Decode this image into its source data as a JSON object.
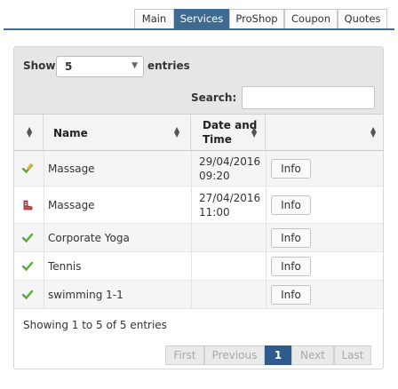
{
  "tabs": [
    {
      "label": "Main",
      "active": false
    },
    {
      "label": "Services",
      "active": true
    },
    {
      "label": "ProShop",
      "active": false
    },
    {
      "label": "Coupon",
      "active": false
    },
    {
      "label": "Quotes",
      "active": false
    }
  ],
  "controls": {
    "show_label": "Show",
    "page_size": "5",
    "entries_label": "entries",
    "search_label": "Search:",
    "search_value": ""
  },
  "table": {
    "headers": {
      "status": "",
      "name": "Name",
      "date_line1": "Date and",
      "date_line2": "Time",
      "action": ""
    },
    "rows": [
      {
        "status_icon": "check-pencil-icon",
        "name": "Massage",
        "date": "29/04/2016",
        "time": "09:20",
        "action": "Info"
      },
      {
        "status_icon": "pending-shoe-icon",
        "name": "Massage",
        "date": "27/04/2016",
        "time": "11:00",
        "action": "Info"
      },
      {
        "status_icon": "check-icon",
        "name": "Corporate Yoga",
        "date": "",
        "time": "",
        "action": "Info"
      },
      {
        "status_icon": "check-icon",
        "name": "Tennis",
        "date": "",
        "time": "",
        "action": "Info"
      },
      {
        "status_icon": "check-icon",
        "name": "swimming 1-1",
        "date": "",
        "time": "",
        "action": "Info"
      }
    ]
  },
  "summary": "Showing 1 to 5 of 5 entries",
  "pagination": {
    "first": "First",
    "previous": "Previous",
    "current": "1",
    "next": "Next",
    "last": "Last"
  },
  "colors": {
    "accent": "#3f6b93",
    "check_green": "#5aa832",
    "pager_active": "#2f5c8c"
  }
}
